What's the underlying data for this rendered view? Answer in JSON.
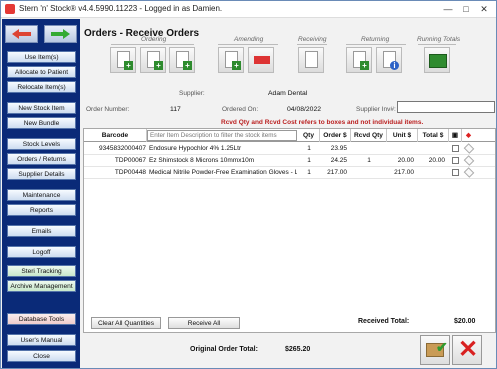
{
  "window": {
    "title": "Stern 'n' Stock® v4.4.5990.11223 - Logged in as Damien.",
    "controls": [
      "—",
      "□",
      "✕"
    ]
  },
  "sidebar": {
    "buttons": [
      "Use Item(s)",
      "Allocate to Patient",
      "Relocate Item(s)",
      "New Stock Item",
      "New Bundle",
      "Stock Levels",
      "Orders / Returns",
      "Supplier Details",
      "Maintenance",
      "Reports",
      "Emails",
      "Logoff",
      "Steri Tracking",
      "Archive Management",
      "Database Tools",
      "User's Manual",
      "Close"
    ]
  },
  "page": {
    "title": "Orders  - Receive Orders",
    "groups": [
      "Ordering",
      "Amending",
      "Receiving",
      "Returning",
      "Running Totals"
    ]
  },
  "order": {
    "supplier_label": "Supplier:",
    "supplier_value": "Adam Dental",
    "order_number_label": "Order Number:",
    "order_number_value": "117",
    "ordered_on_label": "Ordered On:",
    "ordered_on_value": "04/08/2022",
    "supplier_inv_label": "Supplier Inv#:",
    "notice": "Rcvd Qty and Rcvd Cost refers to boxes and not individual items."
  },
  "table": {
    "headers": [
      "Barcode",
      "Qty",
      "Order $",
      "Rcvd Qty",
      "Unit $",
      "Total $"
    ],
    "filter_placeholder": "Enter Item Description to filter the stock items",
    "rows": [
      {
        "barcode": "9345832000407",
        "desc": "Endosure Hypochlor 4% 1.25Ltr",
        "qty": "1",
        "order": "23.95",
        "rcvd": "",
        "unit": "",
        "total": ""
      },
      {
        "barcode": "TDP00067",
        "desc": "Ez Shimstock 8 Microns 10mmx10m",
        "qty": "1",
        "order": "24.25",
        "rcvd": "1",
        "unit": "20.00",
        "total": "20.00"
      },
      {
        "barcode": "TDP00448",
        "desc": "Medical Nitrile Powder-Free Examination Gloves - L...",
        "qty": "1",
        "order": "217.00",
        "rcvd": "",
        "unit": "217.00",
        "total": ""
      }
    ]
  },
  "footer": {
    "clear_button": "Clear All Quantities",
    "receive_all_button": "Receive All",
    "received_total_label": "Received Total:",
    "received_total_value": "$20.00",
    "original_total_label": "Original Order Total:",
    "original_total_value": "$265.20"
  }
}
